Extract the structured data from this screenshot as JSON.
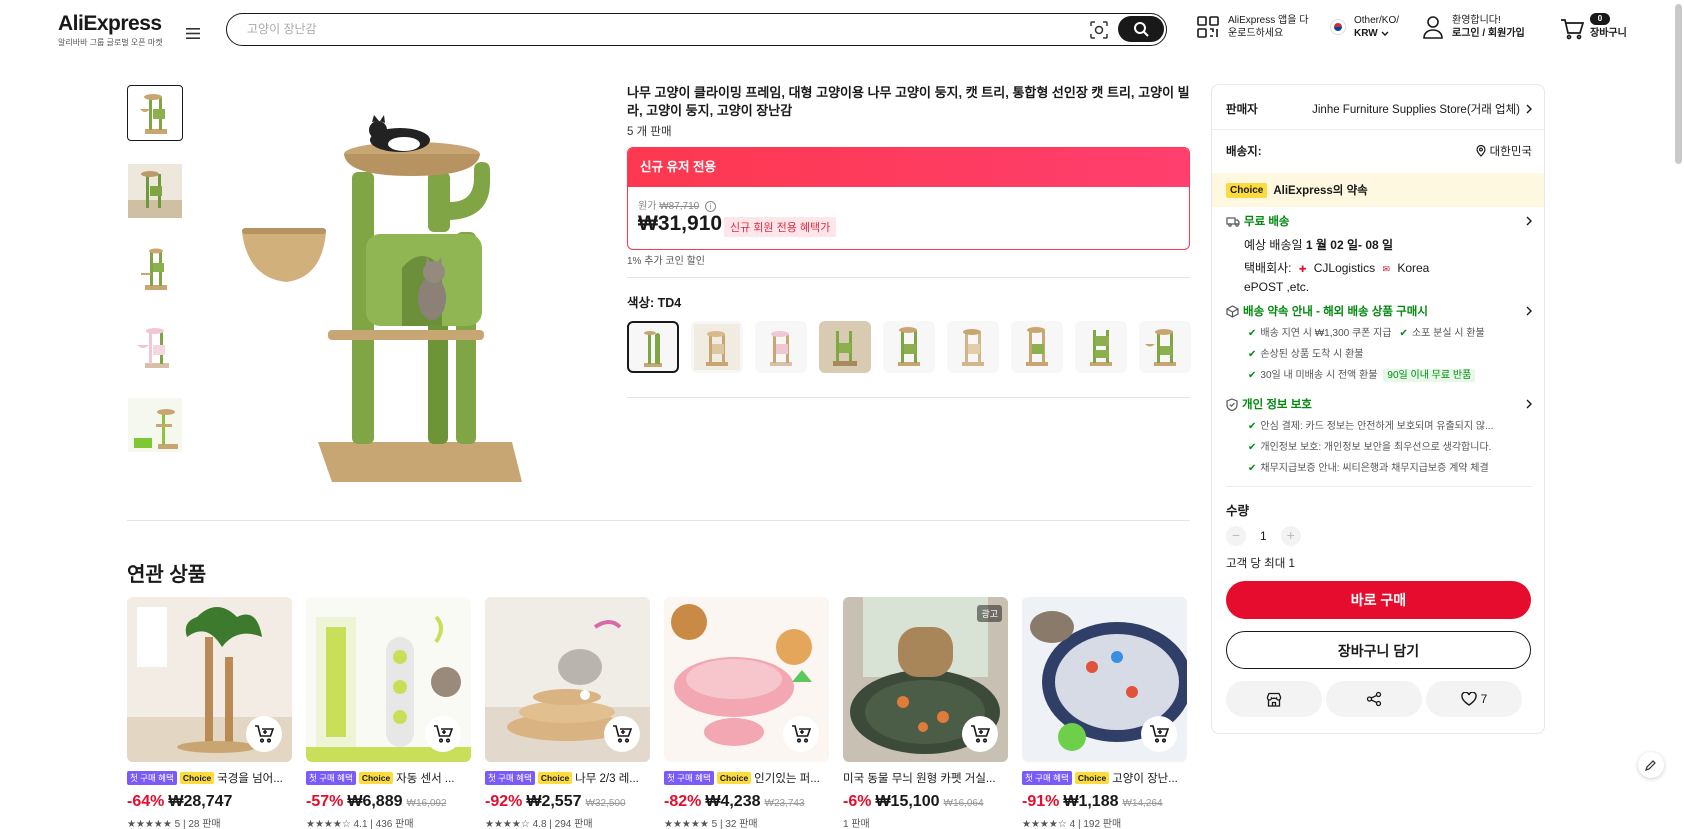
{
  "header": {
    "logo": "AliExpress",
    "logo_sub": "알리바바 그룹 글로벌 오픈 마켓",
    "search_placeholder": "고양이 장난감",
    "app_line1": "AliExpress 앱을 다",
    "app_line2": "운로드하세요",
    "region_line1": "Other/KO/",
    "region_line2": "KRW",
    "account_line1": "환영합니다!",
    "account_line2": "로그인 / 회원가입",
    "cart_count": "0",
    "cart_label": "장바구니"
  },
  "product": {
    "title": "나무 고양이 클라이밍 프레임, 대형 고양이용 나무 고양이 둥지, 캣 트리, 통합형 선인장 캣 트리, 고양이 빌라, 고양이 둥지, 고양이 장난감",
    "sold": "5 개 판매",
    "promo_header": "신규 유저 전용",
    "orig_label": "원가",
    "orig_price": "₩87,710",
    "price": "₩31,910",
    "price_badge": "신규 회원 전용 혜택가",
    "coin_note": "1% 추가 코인 할인",
    "color_label": "색상: TD4",
    "accent": "#fd384f"
  },
  "panel": {
    "seller_label": "판매자",
    "seller_name": "Jinhe Furniture Supplies Store(거래 업체)",
    "ship_to_label": "배송지:",
    "ship_to_value": "대한민국",
    "choice_tag": "Choice",
    "choice_text": "AliExpress의 약속",
    "free_ship": "무료 배송",
    "eta_prefix": "예상 배송일",
    "eta_value": "1 월 02 일- 08 일",
    "carrier_prefix": "택배회사:",
    "carrier1": "CJLogistics",
    "carrier2_a": "Korea",
    "carrier2_b": "ePOST ,etc.",
    "promise_title": "배송 약속 안내 - 해외 배송 상품 구매시",
    "promise_1": "배송 지연 시 ₩1,300 쿠폰 지급",
    "promise_2": "소포 분실 시 환불",
    "promise_3": "손상된 상품 도착 시 환불",
    "promise_4": "30일 내 미배송 시 전액 환불",
    "promise_badge": "90일 이내 무료 반품",
    "privacy_title": "개인 정보 보호",
    "privacy_1": "안심 결제: 카드 정보는 안전하게 보호되며 유출되지 않...",
    "privacy_2": "개인정보 보호: 개인정보 보안을 최우선으로 생각합니다.",
    "privacy_3": "채무지급보증 안내: 씨티은행과 채무지급보증 계약 체결",
    "qty_label": "수량",
    "qty_value": "1",
    "qty_limit": "고객 당 최대 1",
    "buy_now": "바로 구매",
    "add_cart": "장바구니 담기",
    "wish_count": "7"
  },
  "related": {
    "title": "연관 상품",
    "tag_first": "첫 구매 혜택",
    "tag_choice": "Choice",
    "ad_label": "광고",
    "items": [
      {
        "title": "국경을 넘어...",
        "disc": "-64%",
        "price": "₩28,747",
        "orig": "",
        "rating": "★★★★★ 5 | 28 판매"
      },
      {
        "title": "자동 센서 ...",
        "disc": "-57%",
        "price": "₩6,889",
        "orig": "₩16,092",
        "rating": "★★★★☆ 4.1 | 436 판매"
      },
      {
        "title": "나무 2/3 레...",
        "disc": "-92%",
        "price": "₩2,557",
        "orig": "₩32,500",
        "rating": "★★★★☆ 4.8 | 294 판매"
      },
      {
        "title": "인기있는 퍼...",
        "disc": "-82%",
        "price": "₩4,238",
        "orig": "₩23,743",
        "rating": "★★★★★ 5 | 32 판매"
      },
      {
        "title": "미국 동물 무늬 원형 카펫 거실...",
        "disc": "-6%",
        "price": "₩15,100",
        "orig": "₩16,064",
        "rating": "1 판매"
      },
      {
        "title": "고양이 장난...",
        "disc": "-91%",
        "price": "₩1,188",
        "orig": "₩14,264",
        "rating": "★★★★☆ 4 | 192 판매"
      }
    ]
  }
}
